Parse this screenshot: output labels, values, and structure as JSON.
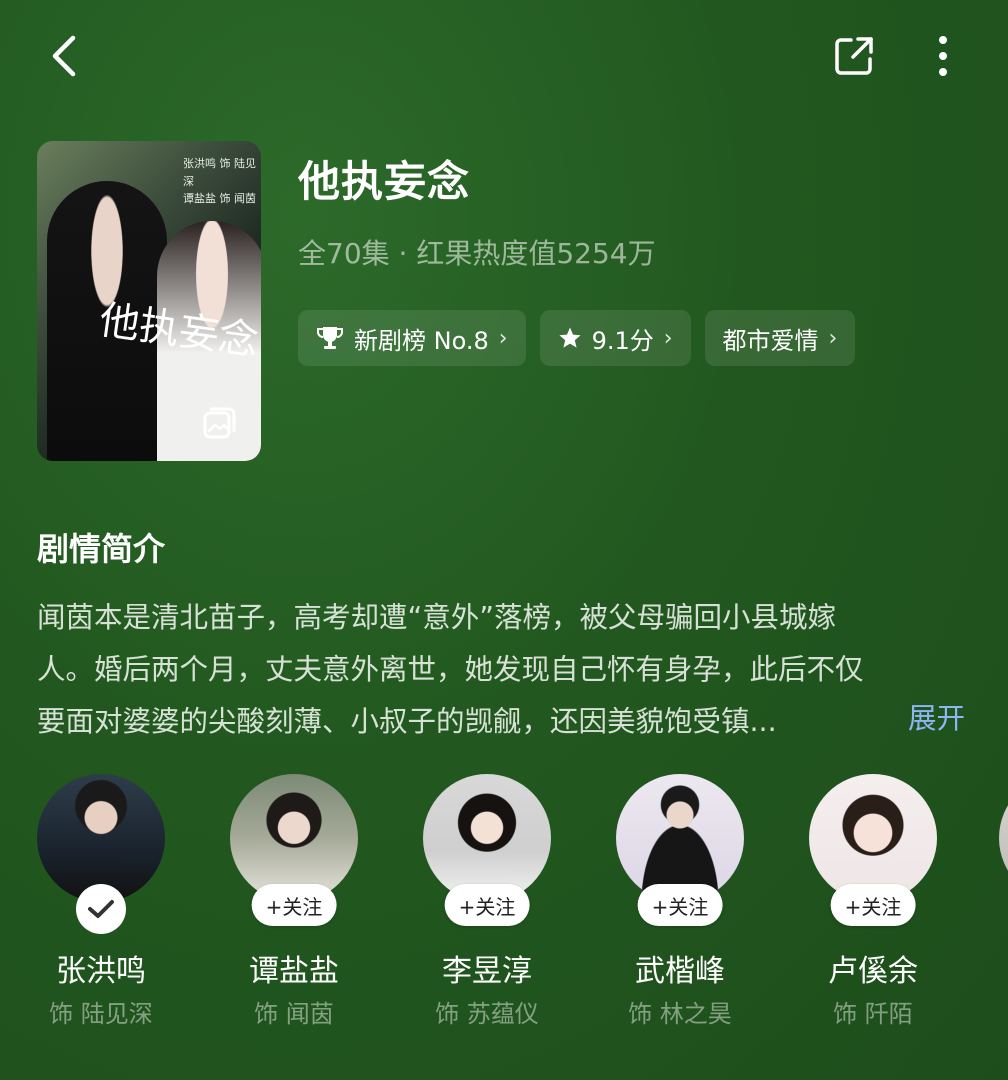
{
  "header": {
    "back_icon": "chevron-left-icon",
    "share_icon": "share-icon",
    "more_icon": "more-vertical-icon"
  },
  "poster": {
    "title_art": "他执妄念",
    "credits": [
      "张洪鸣 饰 陆见深",
      "谭盐盐 饰 闻茵"
    ],
    "gallery_icon": "gallery-icon"
  },
  "show": {
    "title": "他执妄念",
    "meta": "全70集 · 红果热度值5254万",
    "chips": [
      {
        "icon": "trophy-icon",
        "label": "新剧榜 No.8"
      },
      {
        "icon": "star-icon",
        "label": "9.1分"
      },
      {
        "icon": "",
        "label": "都市爱情"
      }
    ]
  },
  "synopsis": {
    "heading": "剧情简介",
    "lines": [
      "闻茵本是清北苗子，高考却遭“意外”落榜，被父母骗回小县城嫁",
      "人。婚后两个月，丈夫意外离世，她发现自己怀有身孕，此后不仅",
      "要面对婆婆的尖酸刻薄、小叔子的觊觎，还因美貌饱受镇..."
    ],
    "expand_label": "展开"
  },
  "cast": [
    {
      "name": "张洪鸣",
      "role": "饰 陆见深",
      "followed": true,
      "badge": ""
    },
    {
      "name": "谭盐盐",
      "role": "饰 闻茵",
      "followed": false,
      "badge": "+关注"
    },
    {
      "name": "李昱淳",
      "role": "饰 苏蕴仪",
      "followed": false,
      "badge": "+关注"
    },
    {
      "name": "武楷峰",
      "role": "饰 林之昊",
      "followed": false,
      "badge": "+关注"
    },
    {
      "name": "卢傒余",
      "role": "饰 阡陌",
      "followed": false,
      "badge": "+关注"
    }
  ],
  "colors": {
    "background": "#22581f",
    "link": "#8fb6f4"
  }
}
